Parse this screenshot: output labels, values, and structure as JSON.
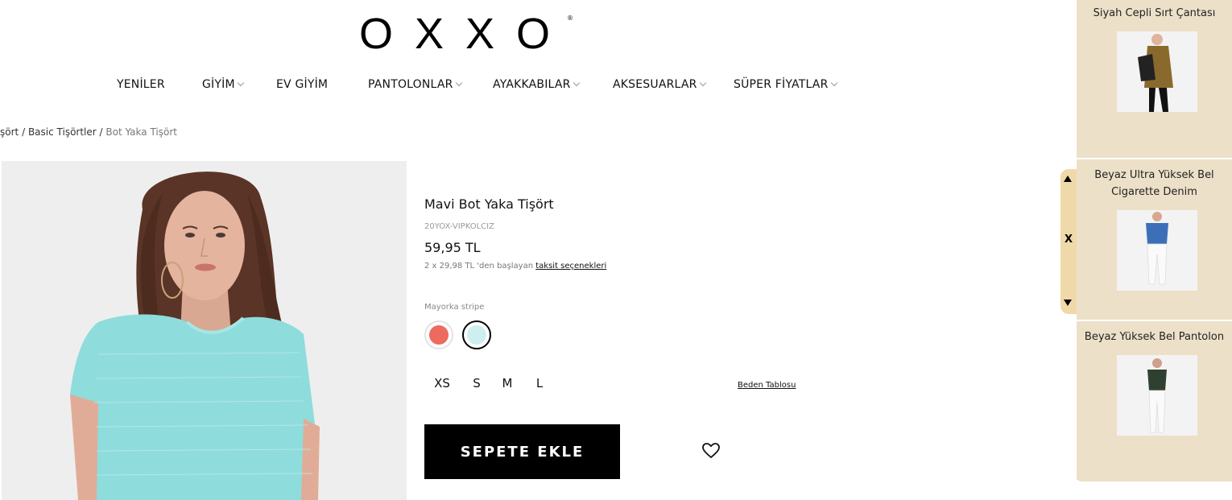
{
  "brand": {
    "logo_text": "OXXO",
    "registered": "®"
  },
  "nav": {
    "items": [
      {
        "label": "YENİLER",
        "has_dropdown": false
      },
      {
        "label": "GİYİM",
        "has_dropdown": true
      },
      {
        "label": "EV GİYİM",
        "has_dropdown": false
      },
      {
        "label": "PANTOLONLAR",
        "has_dropdown": true
      },
      {
        "label": "AYAKKABILAR",
        "has_dropdown": true
      },
      {
        "label": "AKSESUARLAR",
        "has_dropdown": true
      },
      {
        "label": "SÜPER FİYATLAR",
        "has_dropdown": true
      }
    ]
  },
  "breadcrumb": {
    "items": [
      "şört",
      "Basic Tişörtler",
      "Bot Yaka Tişört"
    ],
    "separator": "/"
  },
  "product": {
    "title": "Mavi Bot Yaka Tişört",
    "sku": "20YOX-VIPKOLCIZ",
    "price": "59,95 TL",
    "installment_prefix": "2 x 29,98 TL 'den başlayan",
    "installment_link": "taksit seçenekleri",
    "color_label": "Mayorka stripe",
    "colors": [
      {
        "name": "coral",
        "hex": "#ec6a5e",
        "selected": false
      },
      {
        "name": "mint",
        "hex": "#cdeff0",
        "selected": true
      }
    ],
    "sizes": [
      "XS",
      "S",
      "M",
      "L"
    ],
    "size_chart_label": "Beden Tablosu",
    "add_to_cart_label": "SEPETE EKLE"
  },
  "recommendations": {
    "items": [
      {
        "title": "Siyah Cepli Sırt Çantası"
      },
      {
        "title": "Beyaz Ultra Yüksek Bel Cigarette Denim"
      },
      {
        "title": "Beyaz Yüksek Bel Pantolon"
      }
    ],
    "close_label": "X"
  },
  "colors": {
    "panel_bg": "#ede0c8",
    "scroller_bg": "#f0d9a8",
    "button_bg": "#000000"
  }
}
